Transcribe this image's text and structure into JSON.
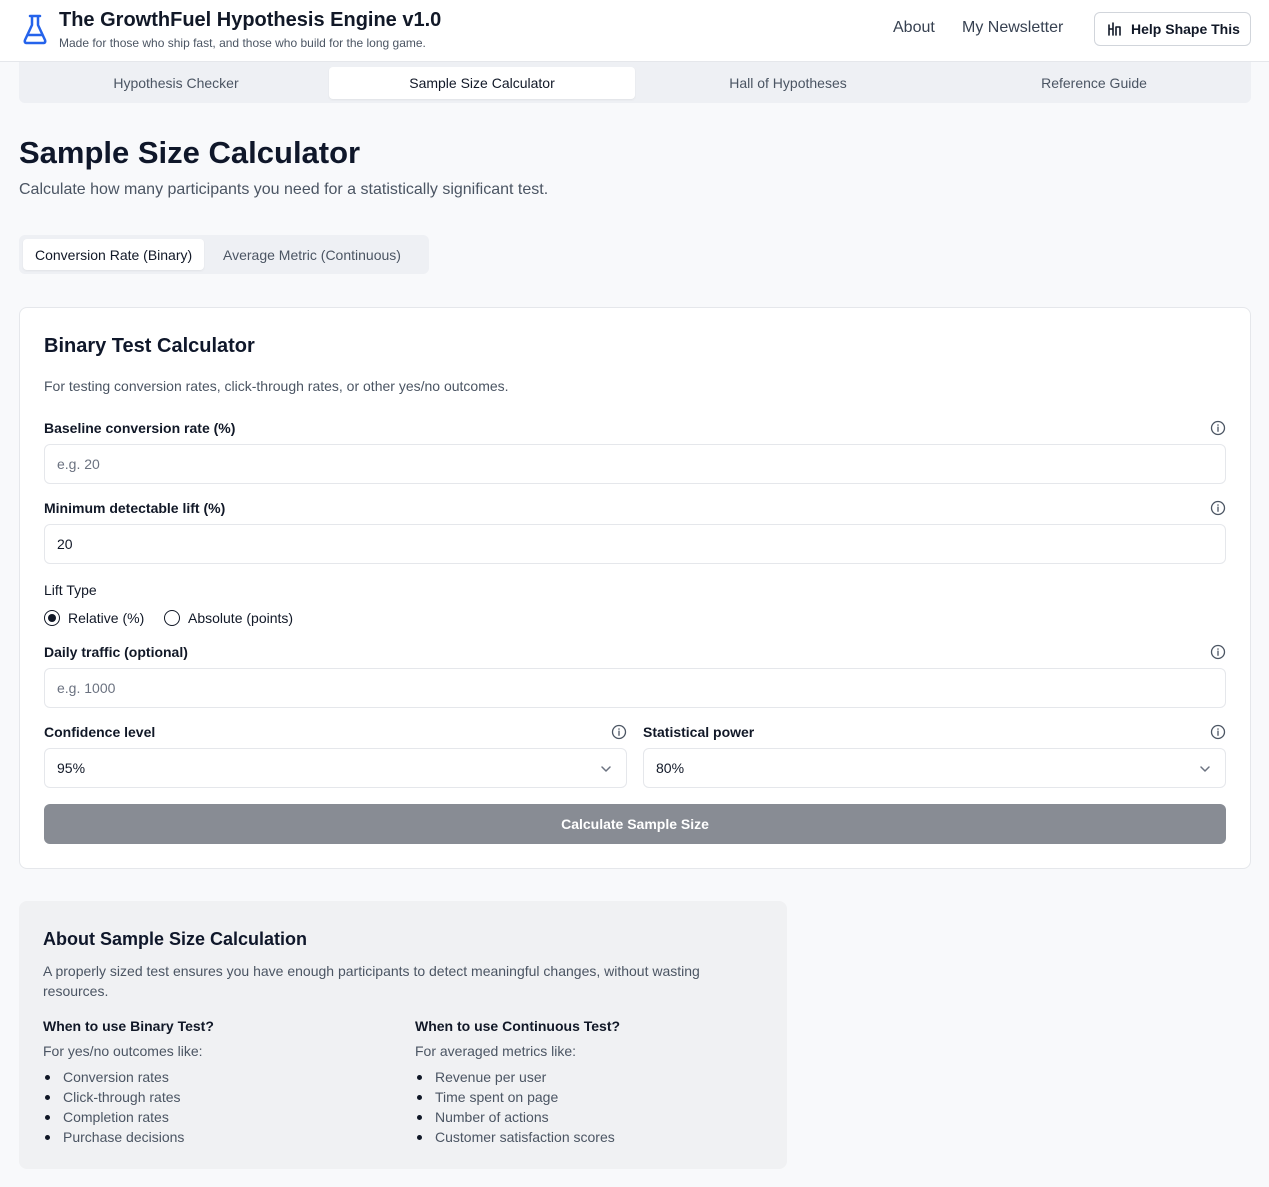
{
  "header": {
    "title": "The GrowthFuel Hypothesis Engine v1.0",
    "tagline": "Made for those who ship fast, and those who build for the long game.",
    "nav": [
      "About",
      "My Newsletter"
    ],
    "help_button": "Help Shape This",
    "accent_color": "#2563eb"
  },
  "main_tabs": [
    {
      "label": "Hypothesis Checker",
      "active": false
    },
    {
      "label": "Sample Size Calculator",
      "active": true
    },
    {
      "label": "Hall of Hypotheses",
      "active": false
    },
    {
      "label": "Reference Guide",
      "active": false
    }
  ],
  "page": {
    "title": "Sample Size Calculator",
    "subtitle": "Calculate how many participants you need for a statistically significant test."
  },
  "sub_tabs": [
    {
      "label": "Conversion Rate (Binary)",
      "active": true
    },
    {
      "label": "Average Metric (Continuous)",
      "active": false
    }
  ],
  "calculator": {
    "title": "Binary Test Calculator",
    "description": "For testing conversion rates, click-through rates, or other yes/no outcomes.",
    "baseline": {
      "label": "Baseline conversion rate (%)",
      "value": "",
      "placeholder": "e.g. 20"
    },
    "lift": {
      "label": "Minimum detectable lift (%)",
      "value": "20",
      "placeholder": ""
    },
    "lift_type": {
      "label": "Lift Type",
      "options": [
        "Relative (%)",
        "Absolute (points)"
      ],
      "selected": "Relative (%)"
    },
    "traffic": {
      "label": "Daily traffic (optional)",
      "value": "",
      "placeholder": "e.g. 1000"
    },
    "confidence": {
      "label": "Confidence level",
      "value": "95%"
    },
    "power": {
      "label": "Statistical power",
      "value": "80%"
    },
    "button": "Calculate Sample Size",
    "button_color": "#888c94"
  },
  "about": {
    "title": "About Sample Size Calculation",
    "description": "A properly sized test ensures you have enough participants to detect meaningful changes, without wasting resources.",
    "binary": {
      "heading": "When to use Binary Test?",
      "sub": "For yes/no outcomes like:",
      "items": [
        "Conversion rates",
        "Click-through rates",
        "Completion rates",
        "Purchase decisions"
      ]
    },
    "continuous": {
      "heading": "When to use Continuous Test?",
      "sub": "For averaged metrics like:",
      "items": [
        "Revenue per user",
        "Time spent on page",
        "Number of actions",
        "Customer satisfaction scores"
      ]
    }
  },
  "icons": {
    "logo": "flask-icon",
    "help": "bar-chart-icon",
    "info": "info-circle-icon",
    "select": "chevron-down-icon"
  }
}
